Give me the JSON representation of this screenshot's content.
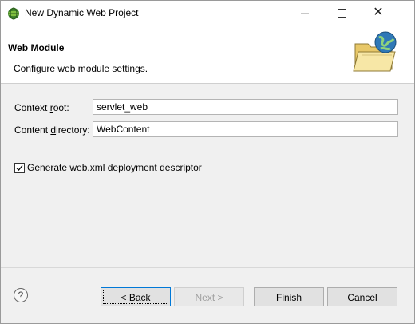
{
  "window": {
    "title": "New Dynamic Web Project",
    "controls": {
      "minimize": "—",
      "maximize": "☐",
      "close": "✕"
    }
  },
  "banner": {
    "title": "Web Module",
    "description": "Configure web module settings."
  },
  "form": {
    "context_root": {
      "label_pre": "Context ",
      "label_access": "r",
      "label_post": "oot:",
      "value": "servlet_web"
    },
    "content_directory": {
      "label_pre": "Content ",
      "label_access": "d",
      "label_post": "irectory:",
      "value": "WebContent"
    },
    "generate_descriptor": {
      "label_access": "G",
      "label_post": "enerate web.xml deployment descriptor",
      "checked": true
    }
  },
  "buttons": {
    "help": "?",
    "back": {
      "pre": "< ",
      "access": "B",
      "post": "ack"
    },
    "next": "Next >",
    "finish": {
      "access": "F",
      "post": "inish"
    },
    "cancel": "Cancel"
  },
  "colors": {
    "focus_border": "#0078d7",
    "window_bg": "#f0f0f0",
    "disabled_text": "#a0a0a0"
  }
}
